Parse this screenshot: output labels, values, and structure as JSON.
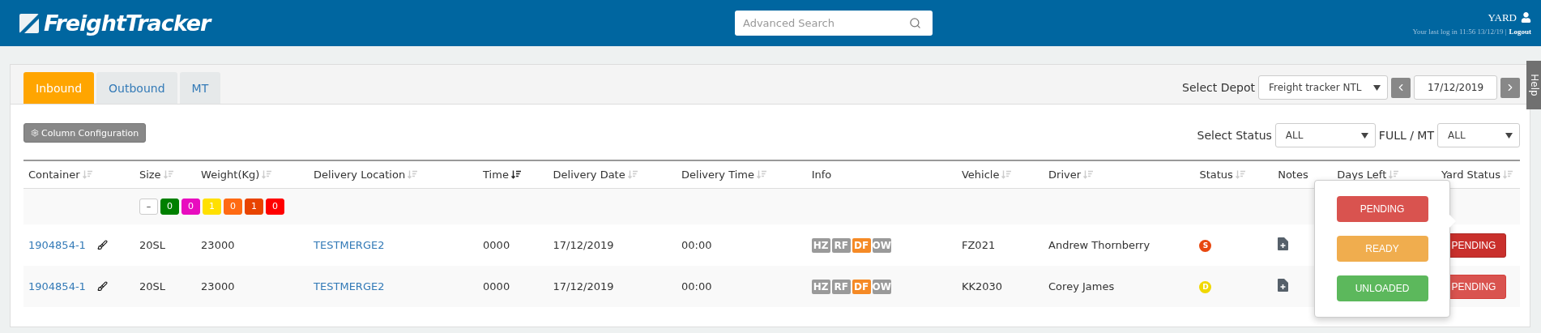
{
  "header": {
    "logo": "FreightTracker",
    "search": {
      "placeholder": "Advanced Search"
    },
    "user": "YARD",
    "last_login": "Your last log in 11:56 13/12/19 |",
    "logout": "Logout"
  },
  "tabs": [
    {
      "label": "Inbound",
      "selected": true
    },
    {
      "label": "Outbound",
      "selected": false
    },
    {
      "label": "MT",
      "selected": false
    }
  ],
  "depot": {
    "label": "Select Depot",
    "value": "Freight tracker NTL",
    "date": "17/12/2019"
  },
  "help": "Help",
  "filters": {
    "column_config": "Column Configuration",
    "status_label": "Select Status",
    "status_value": "ALL",
    "fullmt_label": "FULL / MT",
    "fullmt_value": "ALL"
  },
  "table": {
    "columns": [
      {
        "label": "Container",
        "sortable": true,
        "sorted": false
      },
      {
        "label": "Size",
        "sortable": true,
        "sorted": false
      },
      {
        "label": "Weight(Kg)",
        "sortable": true,
        "sorted": false
      },
      {
        "label": "Delivery Location",
        "sortable": true,
        "sorted": false
      },
      {
        "label": "Time",
        "sortable": true,
        "sorted": true
      },
      {
        "label": "Delivery Date",
        "sortable": true,
        "sorted": false
      },
      {
        "label": "Delivery Time",
        "sortable": true,
        "sorted": false
      },
      {
        "label": "Info",
        "sortable": false
      },
      {
        "label": "Vehicle",
        "sortable": true,
        "sorted": false
      },
      {
        "label": "Driver",
        "sortable": true,
        "sorted": false
      },
      {
        "label": "Status",
        "sortable": true,
        "sorted": false
      },
      {
        "label": "Notes",
        "sortable": false
      },
      {
        "label": "Days Left",
        "sortable": true,
        "sorted": false
      },
      {
        "label": "Yard Status",
        "sortable": true,
        "sorted": false
      }
    ],
    "counters": [
      {
        "label": "–",
        "color": "#ffffff"
      },
      {
        "label": "0",
        "color": "#008000"
      },
      {
        "label": "0",
        "color": "#e80cbf"
      },
      {
        "label": "1",
        "color": "#ffe000"
      },
      {
        "label": "0",
        "color": "#ff6a13"
      },
      {
        "label": "1",
        "color": "#e84400"
      },
      {
        "label": "0",
        "color": "#ff0000"
      }
    ],
    "rows": [
      {
        "container": "1904854-1",
        "size": "20SL",
        "weight": "23000",
        "location": "TESTMERGE2",
        "time": "0000",
        "delivery_date": "17/12/2019",
        "delivery_time": "00:00",
        "info": [
          {
            "label": "HZ",
            "active": false
          },
          {
            "label": "RF",
            "active": false
          },
          {
            "label": "DF",
            "active": true
          },
          {
            "label": "OW",
            "active": false
          }
        ],
        "vehicle": "FZ021",
        "driver": "Andrew Thornberry",
        "status": {
          "letter": "S",
          "color": "#e8470f"
        },
        "yard_status": {
          "label": "PENDING",
          "open": true
        }
      },
      {
        "container": "1904854-1",
        "size": "20SL",
        "weight": "23000",
        "location": "TESTMERGE2",
        "time": "0000",
        "delivery_date": "17/12/2019",
        "delivery_time": "00:00",
        "info": [
          {
            "label": "HZ",
            "active": false
          },
          {
            "label": "RF",
            "active": false
          },
          {
            "label": "DF",
            "active": true
          },
          {
            "label": "OW",
            "active": false
          }
        ],
        "vehicle": "KK2030",
        "driver": "Corey James",
        "status": {
          "letter": "D",
          "color": "#f0d800"
        },
        "yard_status": {
          "label": "PENDING",
          "open": false
        }
      }
    ]
  },
  "popover": {
    "options": [
      {
        "label": "PENDING",
        "color": "#d9534f"
      },
      {
        "label": "READY",
        "color": "#f0ad4e"
      },
      {
        "label": "UNLOADED",
        "color": "#5cb85c"
      }
    ]
  }
}
